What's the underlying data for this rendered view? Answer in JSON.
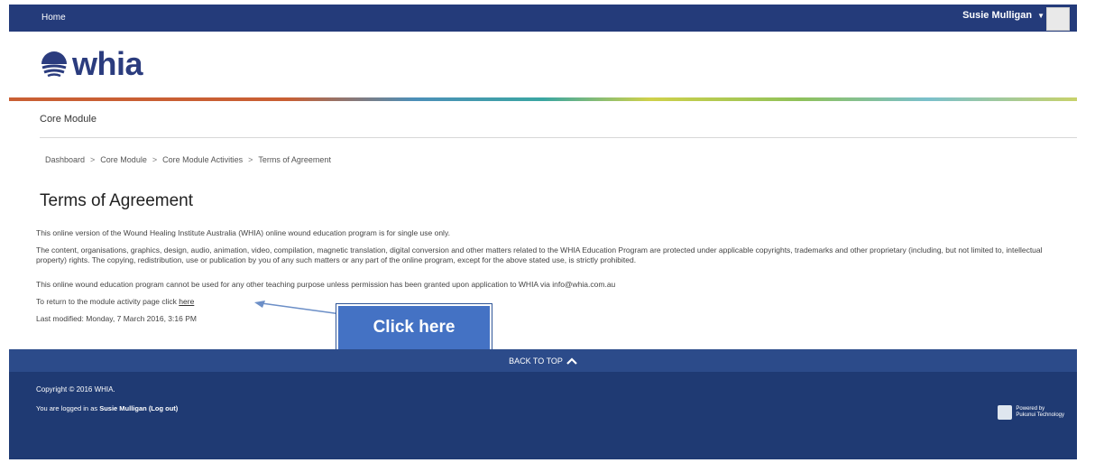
{
  "topnav": {
    "home_label": "Home",
    "user_name": "Susie Mulligan"
  },
  "brand": {
    "name": "whia"
  },
  "section_title": "Core Module",
  "breadcrumb": [
    "Dashboard",
    "Core Module",
    "Core Module Activities",
    "Terms of Agreement"
  ],
  "page_title": "Terms of Agreement",
  "content": {
    "p1": "This online version of the Wound Healing Institute Australia (WHIA) online wound education program is for single use only.",
    "p2": "The content, organisations, graphics, design, audio, animation, video, compilation, magnetic translation, digital conversion and other matters related to the WHIA Education Program are protected under applicable copyrights, trademarks and other proprietary (including, but not limited to, intellectual property) rights.  The copying, redistribution, use or publication by you of any such matters or any part of the online program, except for the above stated use, is strictly prohibited.",
    "p3": "This online wound education program cannot be used for any other teaching purpose unless permission has been granted upon application to WHIA via info@whia.com.au",
    "p4_prefix": "To return to the module activity page click ",
    "p4_link": "here",
    "last_modified": "Last modified: Monday, 7 March 2016, 3:16 PM"
  },
  "callout": "Click here",
  "back_to_top": "BACK TO TOP",
  "footer": {
    "copyright": "Copyright © 2016 WHIA.",
    "logged_in_prefix": "You are logged in as ",
    "logged_in_user": "Susie Mulligan",
    "logout_label": "(Log out)",
    "powered_line1": "Powered by",
    "powered_line2": "Pukunui Technology"
  },
  "colors": {
    "nav": "#243b7a",
    "footer": "#1f3a73",
    "callout": "#4472c4",
    "brand": "#2b3c7e"
  }
}
